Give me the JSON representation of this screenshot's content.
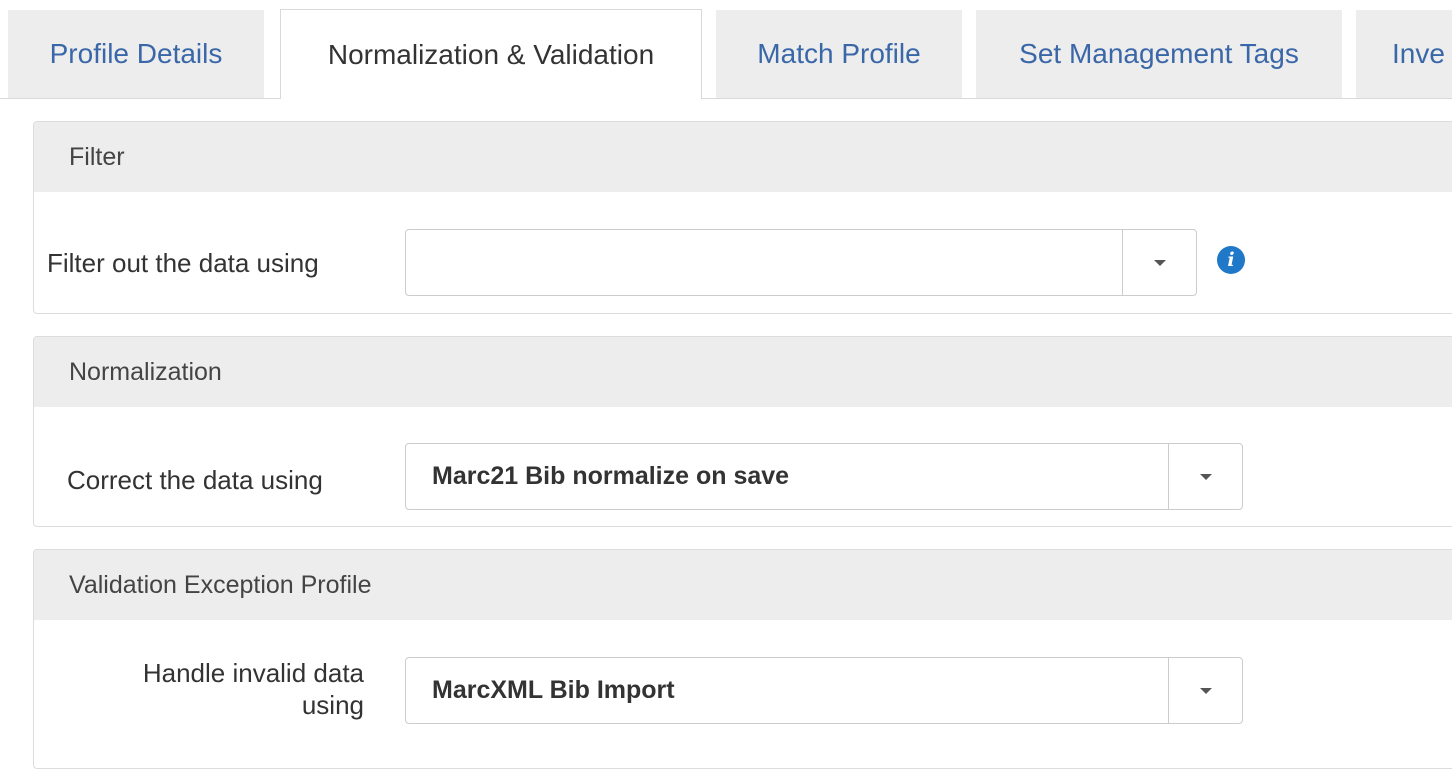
{
  "tabs": [
    {
      "label": "Profile Details",
      "active": false
    },
    {
      "label": "Normalization & Validation",
      "active": true
    },
    {
      "label": "Match Profile",
      "active": false
    },
    {
      "label": "Set Management Tags",
      "active": false
    },
    {
      "label": "Inve",
      "active": false
    }
  ],
  "filter": {
    "header": "Filter",
    "label": "Filter out the data using",
    "value": "",
    "icon": "info-icon"
  },
  "normalization": {
    "header": "Normalization",
    "label": "Correct the data using",
    "value": "Marc21 Bib normalize on save"
  },
  "validation": {
    "header": "Validation Exception Profile",
    "label": "Handle invalid data using",
    "value": "MarcXML Bib Import"
  },
  "colors": {
    "tab_link": "#3a67a8",
    "panel_header_bg": "#ededed",
    "info_icon": "#1f78c8"
  }
}
